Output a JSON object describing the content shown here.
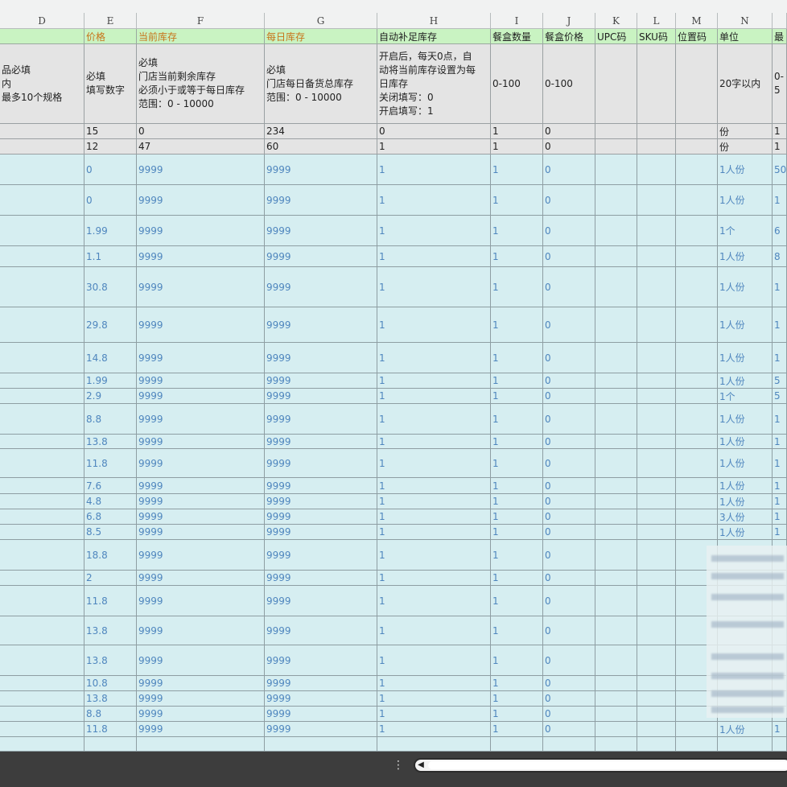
{
  "columns": [
    "D",
    "E",
    "F",
    "G",
    "H",
    "I",
    "J",
    "K",
    "L",
    "M",
    "N",
    ""
  ],
  "fields": [
    "",
    "价格",
    "当前库存",
    "每日库存",
    "自动补足库存",
    "餐盒数量",
    "餐盒价格",
    "UPC码",
    "SKU码",
    "位置码",
    "单位",
    "最"
  ],
  "descriptions": [
    "品必填\n内\n最多10个规格",
    "必填\n填写数字",
    "必填\n门店当前剩余库存\n必须小于或等于每日库存\n范围：0 - 10000",
    "必填\n门店每日备货总库存\n范围：0 - 10000",
    "开启后，每天0点，自\n动将当前库存设置为每\n日库存\n关闭填写：0\n开启填写：1",
    "0-100",
    "0-100",
    "",
    "",
    "",
    "20字以内",
    "0-5"
  ],
  "example_rows": [
    [
      "",
      "15",
      "0",
      "234",
      "0",
      "1",
      "0",
      "",
      "",
      "",
      "份",
      "1"
    ],
    [
      "",
      "12",
      "47",
      "60",
      "1",
      "1",
      "0",
      "",
      "",
      "",
      "份",
      "1"
    ]
  ],
  "data_rows": [
    [
      "",
      "0",
      "9999",
      "9999",
      "1",
      "1",
      "0",
      "",
      "",
      "",
      "1人份",
      "50"
    ],
    [
      "",
      "0",
      "9999",
      "9999",
      "1",
      "1",
      "0",
      "",
      "",
      "",
      "1人份",
      "1"
    ],
    [
      "",
      "1.99",
      "9999",
      "9999",
      "1",
      "1",
      "0",
      "",
      "",
      "",
      "1个",
      "6"
    ],
    [
      "",
      "1.1",
      "9999",
      "9999",
      "1",
      "1",
      "0",
      "",
      "",
      "",
      "1人份",
      "8"
    ],
    [
      "",
      "30.8",
      "9999",
      "9999",
      "1",
      "1",
      "0",
      "",
      "",
      "",
      "1人份",
      "1"
    ],
    [
      "",
      "29.8",
      "9999",
      "9999",
      "1",
      "1",
      "0",
      "",
      "",
      "",
      "1人份",
      "1"
    ],
    [
      "",
      "14.8",
      "9999",
      "9999",
      "1",
      "1",
      "0",
      "",
      "",
      "",
      "1人份",
      "1"
    ],
    [
      "",
      "1.99",
      "9999",
      "9999",
      "1",
      "1",
      "0",
      "",
      "",
      "",
      "1人份",
      "5"
    ],
    [
      "",
      "2.9",
      "9999",
      "9999",
      "1",
      "1",
      "0",
      "",
      "",
      "",
      "1个",
      "5"
    ],
    [
      "",
      "8.8",
      "9999",
      "9999",
      "1",
      "1",
      "0",
      "",
      "",
      "",
      "1人份",
      "1"
    ],
    [
      "",
      "13.8",
      "9999",
      "9999",
      "1",
      "1",
      "0",
      "",
      "",
      "",
      "1人份",
      "1"
    ],
    [
      "",
      "11.8",
      "9999",
      "9999",
      "1",
      "1",
      "0",
      "",
      "",
      "",
      "1人份",
      "1"
    ],
    [
      "",
      "7.6",
      "9999",
      "9999",
      "1",
      "1",
      "0",
      "",
      "",
      "",
      "1人份",
      "1"
    ],
    [
      "",
      "4.8",
      "9999",
      "9999",
      "1",
      "1",
      "0",
      "",
      "",
      "",
      "1人份",
      "1"
    ],
    [
      "",
      "6.8",
      "9999",
      "9999",
      "1",
      "1",
      "0",
      "",
      "",
      "",
      "3人份",
      "1"
    ],
    [
      "",
      "8.5",
      "9999",
      "9999",
      "1",
      "1",
      "0",
      "",
      "",
      "",
      "1人份",
      "1"
    ],
    [
      "",
      "18.8",
      "9999",
      "9999",
      "1",
      "1",
      "0",
      "",
      "",
      "",
      "",
      ""
    ],
    [
      "",
      "2",
      "9999",
      "9999",
      "1",
      "1",
      "0",
      "",
      "",
      "",
      "",
      ""
    ],
    [
      "",
      "11.8",
      "9999",
      "9999",
      "1",
      "1",
      "0",
      "",
      "",
      "",
      "",
      ""
    ],
    [
      "",
      "13.8",
      "9999",
      "9999",
      "1",
      "1",
      "0",
      "",
      "",
      "",
      "",
      ""
    ],
    [
      "",
      "13.8",
      "9999",
      "9999",
      "1",
      "1",
      "0",
      "",
      "",
      "",
      "",
      ""
    ],
    [
      "",
      "10.8",
      "9999",
      "9999",
      "1",
      "1",
      "0",
      "",
      "",
      "",
      "",
      ""
    ],
    [
      "",
      "13.8",
      "9999",
      "9999",
      "1",
      "1",
      "0",
      "",
      "",
      "",
      "",
      ""
    ],
    [
      "",
      "8.8",
      "9999",
      "9999",
      "1",
      "1",
      "0",
      "",
      "",
      "",
      "",
      ""
    ],
    [
      "",
      "11.8",
      "9999",
      "9999",
      "1",
      "1",
      "0",
      "",
      "",
      "",
      "1人份",
      "1"
    ]
  ],
  "scrollbar": {
    "left_arrow": "◀",
    "more_menu": "⋮"
  }
}
